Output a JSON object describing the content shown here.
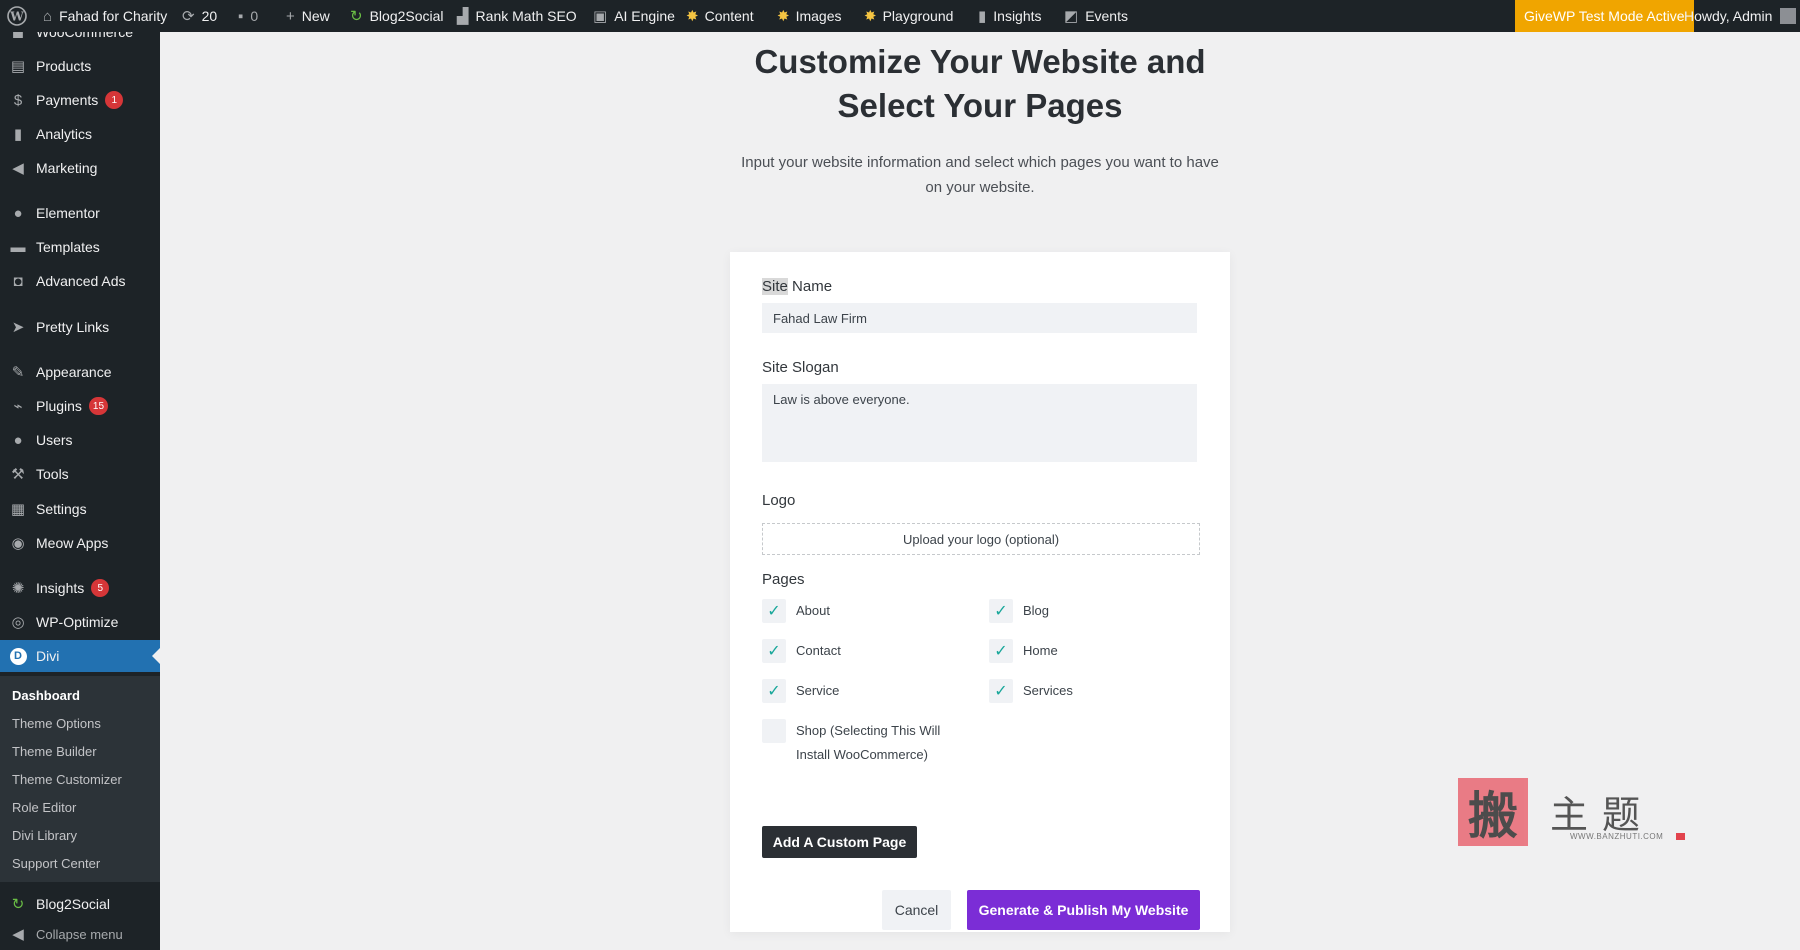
{
  "adminbar": {
    "site_name": "Fahad for Charity",
    "updates_count": "20",
    "comments_count": "0",
    "new_label": "New",
    "blog2social": "Blog2Social",
    "rankmath": "Rank Math SEO",
    "aiengine": "AI Engine",
    "content": "Content",
    "images": "Images",
    "playground": "Playground",
    "insights": "Insights",
    "events": "Events",
    "givewp_notice": "GiveWP Test Mode Active",
    "howdy": "Howdy, Admin"
  },
  "sidebar": {
    "woocommerce": "WooCommerce",
    "products": "Products",
    "payments": "Payments",
    "payments_badge": "1",
    "analytics": "Analytics",
    "marketing": "Marketing",
    "elementor": "Elementor",
    "templates": "Templates",
    "advanced_ads": "Advanced Ads",
    "pretty_links": "Pretty Links",
    "appearance": "Appearance",
    "plugins": "Plugins",
    "plugins_badge": "15",
    "users": "Users",
    "tools": "Tools",
    "settings": "Settings",
    "meow_apps": "Meow Apps",
    "insights": "Insights",
    "insights_badge": "5",
    "wp_optimize": "WP-Optimize",
    "divi": "Divi",
    "divi_sub": [
      "Dashboard",
      "Theme Options",
      "Theme Builder",
      "Theme Customizer",
      "Role Editor",
      "Divi Library",
      "Support Center"
    ],
    "blog2social": "Blog2Social",
    "collapse": "Collapse menu"
  },
  "main": {
    "title_line1": "Customize Your Website and",
    "title_line2": "Select Your Pages",
    "subtitle_line1": "Input your website information and select which pages you want to have",
    "subtitle_line2": "on your website.",
    "form": {
      "site_name_label_hl": "Site",
      "site_name_label_rest": " Name",
      "site_name_value": "Fahad Law Firm",
      "site_slogan_label": "Site Slogan",
      "site_slogan_value": "Law is above everyone.",
      "logo_label": "Logo",
      "upload_logo": "Upload your logo (optional)",
      "pages_label": "Pages",
      "pages": [
        {
          "label": "About",
          "checked": true
        },
        {
          "label": "Blog",
          "checked": true
        },
        {
          "label": "Contact",
          "checked": true
        },
        {
          "label": "Home",
          "checked": true
        },
        {
          "label": "Service",
          "checked": true
        },
        {
          "label": "Services",
          "checked": true
        },
        {
          "label": "Shop (Selecting This Will Install WooCommerce)",
          "checked": false
        }
      ],
      "add_custom_page": "Add A Custom Page",
      "cancel": "Cancel",
      "publish": "Generate & Publish My Website"
    }
  },
  "watermark": {
    "char": "搬",
    "text": "主题",
    "url": "WWW.BANZHUTI.COM"
  },
  "colors": {
    "adminbar_bg": "#1d2327",
    "accent_blue": "#2271b1",
    "publish_purple": "#7b2dd6",
    "check_teal": "#18a79a",
    "givewp_orange": "#f0a500",
    "badge_red": "#d63638"
  }
}
